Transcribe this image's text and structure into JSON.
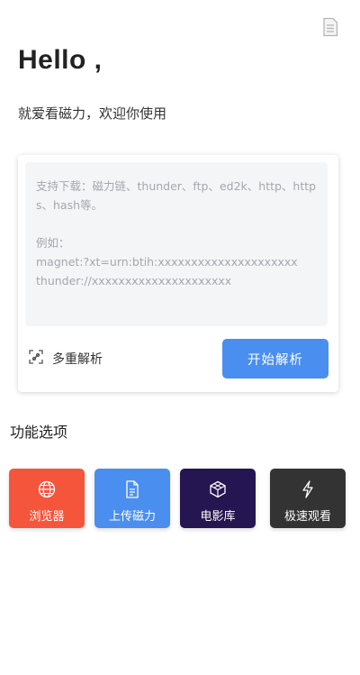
{
  "header": {
    "greeting": "Hello ,",
    "subtitle": "就爱看磁力，欢迎你使用"
  },
  "parser": {
    "placeholder": "支持下载：磁力链、thunder、ftp、ed2k、http、https、hash等。\n\n例如：\nmagnet:?xt=urn:btih:xxxxxxxxxxxxxxxxxxxxx\nthunder://xxxxxxxxxxxxxxxxxxxxx",
    "value": "",
    "multi_parse_label": "多重解析",
    "start_button_label": "开始解析",
    "accent_color": "#4a8ef0"
  },
  "features": {
    "title": "功能选项",
    "items": [
      {
        "label": "浏览器",
        "icon": "globe-icon",
        "color": "#f5553a"
      },
      {
        "label": "上传磁力",
        "icon": "document-icon",
        "color": "#4a8ef0"
      },
      {
        "label": "电影库",
        "icon": "cube-icon",
        "color": "#251550"
      },
      {
        "label": "极速观看",
        "icon": "lightning-icon",
        "color": "#333333"
      }
    ]
  },
  "top_bar": {
    "icon": "document-list-icon"
  }
}
